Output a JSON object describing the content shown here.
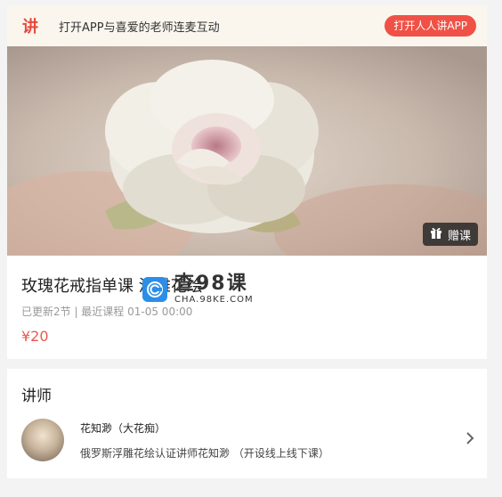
{
  "banner": {
    "logo_char": "讲",
    "text": "打开APP与喜爱的老师连麦互动",
    "open_button": "打开人人讲APP"
  },
  "cover": {
    "gift_label": "赠课",
    "icon": "gift-icon"
  },
  "course": {
    "title": "玫瑰花戒指单课 浮雕花绘",
    "meta": "已更新2节 | 最近课程 01-05 00:00",
    "price": "¥20"
  },
  "watermark": {
    "main": "查98课",
    "sub": "CHA.98KE.COM"
  },
  "teacher_section": {
    "title": "讲师",
    "name": "花知渺（大花痴）",
    "description": "俄罗斯浮雕花绘认证讲师花知渺 （开设线上线下课）",
    "icon": "chevron-right-icon"
  },
  "colors": {
    "accent": "#f05146",
    "price": "#e85a4f",
    "banner_bg": "#faf6ee"
  }
}
